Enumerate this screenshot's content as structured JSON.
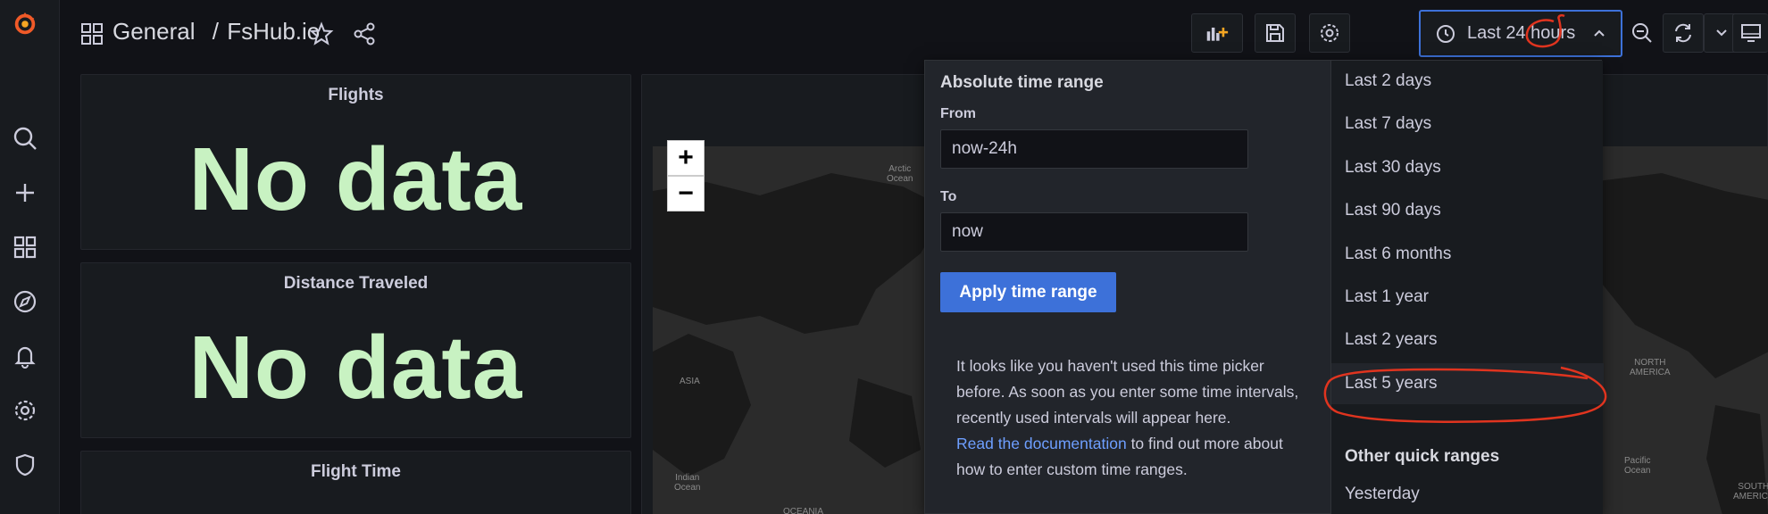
{
  "breadcrumb": {
    "folder": "General",
    "separator": "/",
    "dashboard": "FsHub.io"
  },
  "time_picker": {
    "label": "Last 24 hours"
  },
  "panels": {
    "flights": {
      "title": "Flights",
      "value": "No data"
    },
    "distance": {
      "title": "Distance Traveled",
      "value": "No data"
    },
    "flight_time": {
      "title": "Flight Time"
    }
  },
  "map": {
    "zoom_in": "+",
    "zoom_out": "−",
    "labels": {
      "arctic": "Arctic\nOcean",
      "asia": "ASIA",
      "indian": "Indian\nOcean",
      "oceania": "OCEANIA",
      "north_america": "NORTH\nAMERICA",
      "pacific": "Pacific\nOcean",
      "south_america": "SOUTH\nAMERICA"
    }
  },
  "absolute_range": {
    "title": "Absolute time range",
    "from_label": "From",
    "from_value": "now-24h",
    "to_label": "To",
    "to_value": "now",
    "apply_label": "Apply time range",
    "help_text": "It looks like you haven't used this time picker before. As soon as you enter some time intervals, recently used intervals will appear here.",
    "help_link": "Read the documentation",
    "help_suffix": " to find out more about how to enter custom time ranges."
  },
  "quick_ranges": {
    "items": [
      "Last 2 days",
      "Last 7 days",
      "Last 30 days",
      "Last 90 days",
      "Last 6 months",
      "Last 1 year",
      "Last 2 years",
      "Last 5 years"
    ],
    "other_heading": "Other quick ranges",
    "other_items": [
      "Yesterday"
    ]
  },
  "colors": {
    "accent": "#3d71d9",
    "nodata": "#c8f2c2",
    "annotation": "#e0341f",
    "grafana_orange": "#f05a28"
  }
}
